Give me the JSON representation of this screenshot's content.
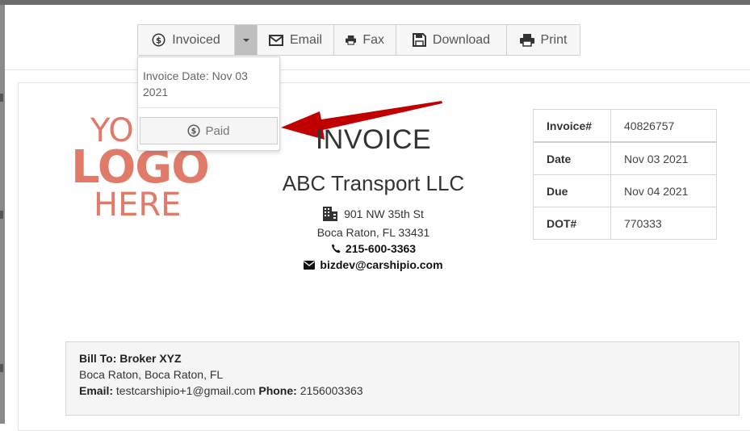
{
  "toolbar": {
    "invoiced_label": "Invoiced",
    "email_label": "Email",
    "fax_label": "Fax",
    "download_label": "Download",
    "print_label": "Print"
  },
  "dropdown": {
    "invoice_date_text": "Invoice Date: Nov 03 2021",
    "paid_label": "Paid"
  },
  "logo": {
    "line1": "YO",
    "line2": "LOGO",
    "line3": "HERE"
  },
  "invoice": {
    "title": "INVOICE",
    "company": "ABC Transport LLC",
    "address_line1": "901 NW 35th St",
    "address_line2": "Boca Raton, FL 33431",
    "phone": "215-600-3363",
    "email": "bizdev@carshipio.com"
  },
  "details": [
    {
      "key": "Invoice#",
      "value": "40826757"
    },
    {
      "key": "Date",
      "value": "Nov 03 2021"
    },
    {
      "key": "Due",
      "value": "Nov 04 2021"
    },
    {
      "key": "DOT#",
      "value": "770333"
    }
  ],
  "bill_to": {
    "label": "Bill To:",
    "name": "Broker XYZ",
    "address": "Boca Raton, Boca Raton, FL",
    "email_label": "Email:",
    "email": "testcarshipio+1@gmail.com",
    "phone_label": "Phone:",
    "phone": "2156003363"
  },
  "colors": {
    "logo": "#e07b6a",
    "arrow": "#c00000",
    "caret_bg": "#bfbfbf"
  }
}
